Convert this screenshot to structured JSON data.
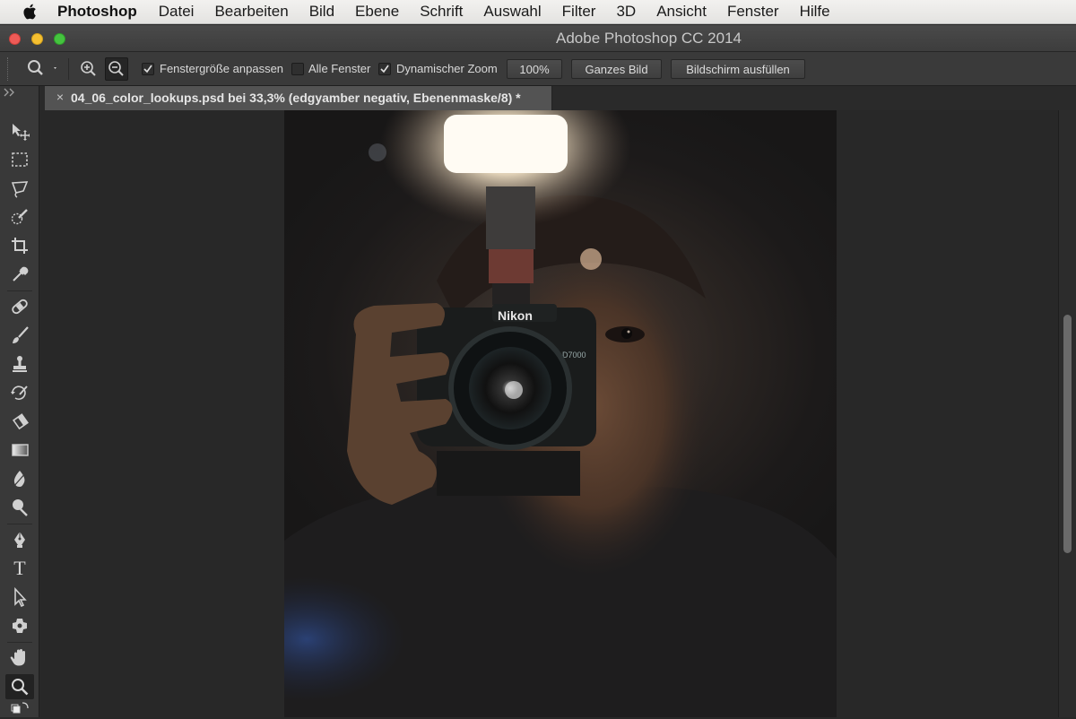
{
  "menubar": {
    "app_name": "Photoshop",
    "items": [
      "Datei",
      "Bearbeiten",
      "Bild",
      "Ebene",
      "Schrift",
      "Auswahl",
      "Filter",
      "3D",
      "Ansicht",
      "Fenster",
      "Hilfe"
    ]
  },
  "window": {
    "title": "Adobe Photoshop CC 2014"
  },
  "options": {
    "resize_windows_label": "Fenstergröße anpassen",
    "resize_windows_checked": true,
    "all_windows_label": "Alle Fenster",
    "all_windows_checked": false,
    "scrubby_zoom_label": "Dynamischer Zoom",
    "scrubby_zoom_checked": true,
    "zoom_100_label": "100%",
    "fit_screen_label": "Ganzes Bild",
    "fill_screen_label": "Bildschirm ausfüllen"
  },
  "document": {
    "tab_title": "04_06_color_lookups.psd bei 33,3% (edgyamber negativ, Ebenenmaske/8) *",
    "close_glyph": "×"
  },
  "photo": {
    "camera_brand": "Nikon",
    "camera_model": "D7000"
  },
  "tools": [
    "move-tool",
    "marquee-tool",
    "lasso-tool",
    "quick-selection-tool",
    "crop-tool",
    "eyedropper-tool",
    "healing-brush-tool",
    "brush-tool",
    "clone-stamp-tool",
    "history-brush-tool",
    "eraser-tool",
    "gradient-tool",
    "blur-tool",
    "dodge-tool",
    "pen-tool",
    "type-tool",
    "path-selection-tool",
    "shape-tool",
    "hand-tool",
    "zoom-tool"
  ],
  "type_tool_glyph": "T",
  "colors": {
    "menubar_bg": "#ebeae8",
    "panel_bg": "#393939",
    "canvas_bg": "#282828",
    "accent_close": "#ee5b57",
    "accent_min": "#f5c031",
    "accent_max": "#45c33f"
  }
}
